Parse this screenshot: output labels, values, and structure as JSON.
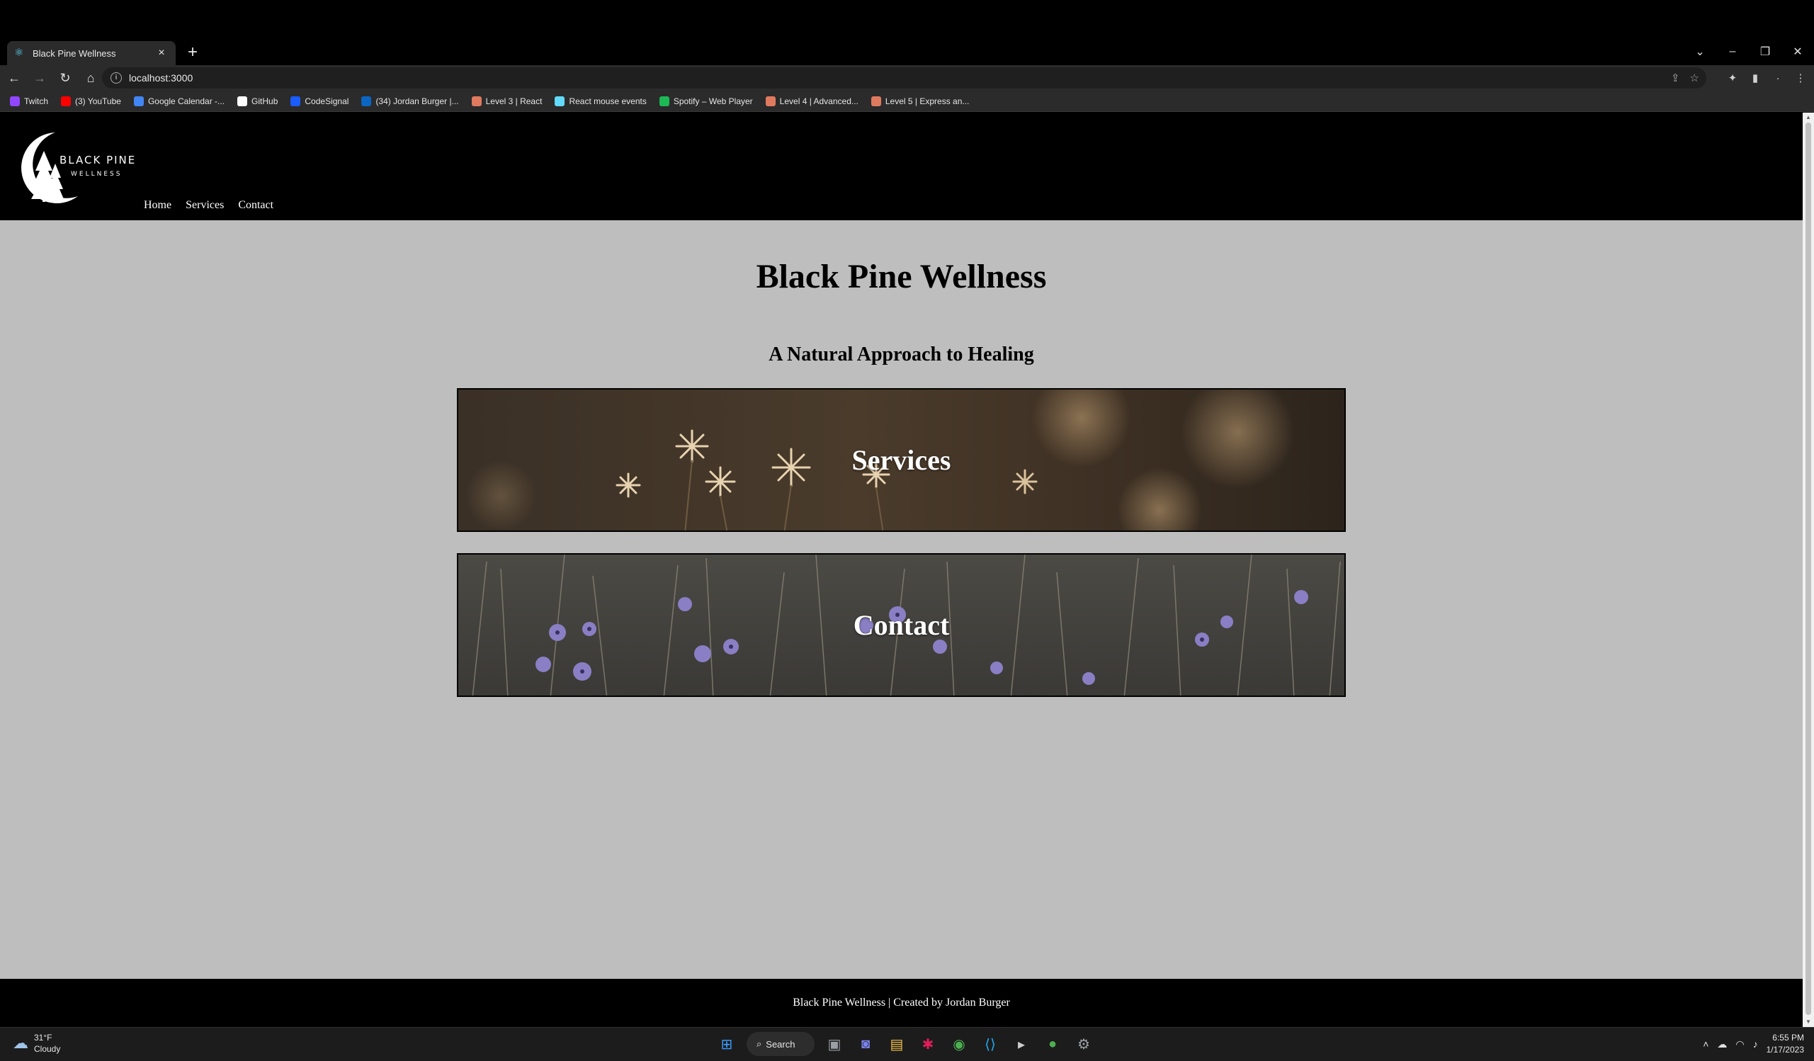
{
  "browser": {
    "tab_title": "Black Pine Wellness",
    "tab_close": "×",
    "new_tab": "+",
    "url": "localhost:3000",
    "window_controls": [
      "⌄",
      "–",
      "❐",
      "✕"
    ],
    "bookmarks": [
      {
        "label": "Twitch",
        "color": "#9146ff"
      },
      {
        "label": "(3) YouTube",
        "color": "#ff0000"
      },
      {
        "label": "Google Calendar -...",
        "color": "#4285f4"
      },
      {
        "label": "GitHub",
        "color": "#ffffff"
      },
      {
        "label": "CodeSignal",
        "color": "#1a5cff"
      },
      {
        "label": "(34) Jordan Burger |...",
        "color": "#0a66c2"
      },
      {
        "label": "Level 3 | React",
        "color": "#e07a5f"
      },
      {
        "label": "React mouse events",
        "color": "#61dafb"
      },
      {
        "label": "Spotify – Web Player",
        "color": "#1db954"
      },
      {
        "label": "Level 4 | Advanced...",
        "color": "#e07a5f"
      },
      {
        "label": "Level 5 | Express an...",
        "color": "#e07a5f"
      }
    ]
  },
  "site": {
    "logo_line1": "BLACK PINE",
    "logo_line2": "WELLNESS",
    "nav": [
      "Home",
      "Services",
      "Contact"
    ],
    "title": "Black Pine Wellness",
    "subtitle": "A Natural Approach to Healing",
    "cards": [
      {
        "label": "Services"
      },
      {
        "label": "Contact"
      }
    ],
    "footer": "Black Pine Wellness | Created by Jordan Burger",
    "colors": {
      "header_bg": "#000000",
      "page_bg": "#bebebe",
      "text": "#000000"
    }
  },
  "taskbar": {
    "weather_temp": "31°F",
    "weather_desc": "Cloudy",
    "search_label": "Search",
    "time": "6:55 PM",
    "date": "1/17/2023"
  }
}
